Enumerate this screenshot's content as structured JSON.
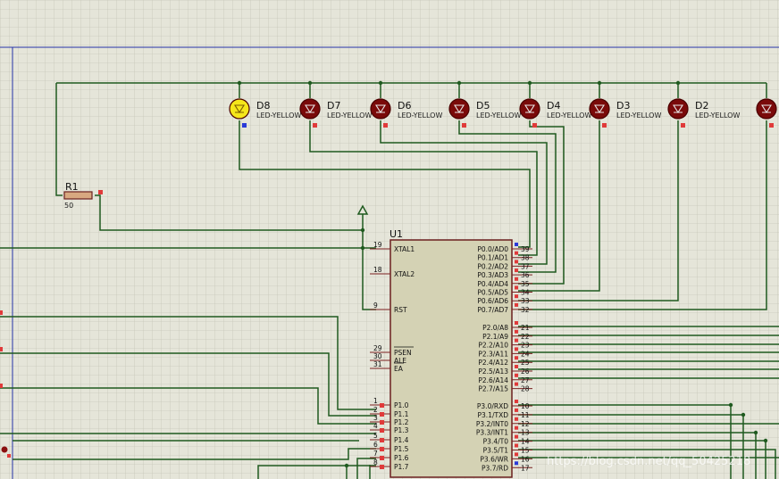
{
  "chip": {
    "ref": "U1",
    "left_pins": [
      {
        "num": "19",
        "name": "XTAL1"
      },
      {
        "num": "18",
        "name": "XTAL2"
      },
      {
        "num": "9",
        "name": "RST"
      },
      {
        "num": "29",
        "name": "PSEN"
      },
      {
        "num": "30",
        "name": "ALE"
      },
      {
        "num": "31",
        "name": "EA"
      },
      {
        "num": "1",
        "name": "P1.0"
      },
      {
        "num": "2",
        "name": "P1.1"
      },
      {
        "num": "3",
        "name": "P1.2"
      },
      {
        "num": "4",
        "name": "P1.3"
      },
      {
        "num": "5",
        "name": "P1.4"
      },
      {
        "num": "6",
        "name": "P1.5"
      },
      {
        "num": "7",
        "name": "P1.6"
      },
      {
        "num": "8",
        "name": "P1.7"
      }
    ],
    "right_pins": [
      {
        "num": "39",
        "name": "P0.0/AD0"
      },
      {
        "num": "38",
        "name": "P0.1/AD1"
      },
      {
        "num": "37",
        "name": "P0.2/AD2"
      },
      {
        "num": "36",
        "name": "P0.3/AD3"
      },
      {
        "num": "35",
        "name": "P0.4/AD4"
      },
      {
        "num": "34",
        "name": "P0.5/AD5"
      },
      {
        "num": "33",
        "name": "P0.6/AD6"
      },
      {
        "num": "32",
        "name": "P0.7/AD7"
      },
      {
        "num": "21",
        "name": "P2.0/A8"
      },
      {
        "num": "22",
        "name": "P2.1/A9"
      },
      {
        "num": "23",
        "name": "P2.2/A10"
      },
      {
        "num": "24",
        "name": "P2.3/A11"
      },
      {
        "num": "25",
        "name": "P2.4/A12"
      },
      {
        "num": "26",
        "name": "P2.5/A13"
      },
      {
        "num": "27",
        "name": "P2.6/A14"
      },
      {
        "num": "28",
        "name": "P2.7/A15"
      },
      {
        "num": "10",
        "name": "P3.0/RXD"
      },
      {
        "num": "11",
        "name": "P3.1/TXD"
      },
      {
        "num": "12",
        "name": "P3.2/INT0"
      },
      {
        "num": "13",
        "name": "P3.3/INT1"
      },
      {
        "num": "14",
        "name": "P3.4/T0"
      },
      {
        "num": "15",
        "name": "P3.5/T1"
      },
      {
        "num": "16",
        "name": "P3.6/WR"
      },
      {
        "num": "17",
        "name": "P3.7/RD"
      }
    ]
  },
  "leds": [
    {
      "ref": "D8",
      "part": "LED-YELLOW",
      "lit": true
    },
    {
      "ref": "D7",
      "part": "LED-YELLOW",
      "lit": false
    },
    {
      "ref": "D6",
      "part": "LED-YELLOW",
      "lit": false
    },
    {
      "ref": "D5",
      "part": "LED-YELLOW",
      "lit": false
    },
    {
      "ref": "D4",
      "part": "LED-YELLOW",
      "lit": false
    },
    {
      "ref": "D3",
      "part": "LED-YELLOW",
      "lit": false
    },
    {
      "ref": "D2",
      "part": "LED-YELLOW",
      "lit": false
    },
    {
      "ref": "",
      "part": "",
      "lit": false
    }
  ],
  "resistor": {
    "ref": "R1",
    "value": "50"
  },
  "watermark": "https://blog.csdn.net/qq_50425218",
  "colors": {
    "background": "#e5e5d9",
    "wire": "#1f5a1f",
    "chip_body": "#d4d2b4",
    "chip_border": "#6b1f1f",
    "led_off": "#7a0a0a",
    "led_on": "#f5e61a",
    "pin_marker": "#e03a3a",
    "sheet_border": "#2533a8"
  }
}
